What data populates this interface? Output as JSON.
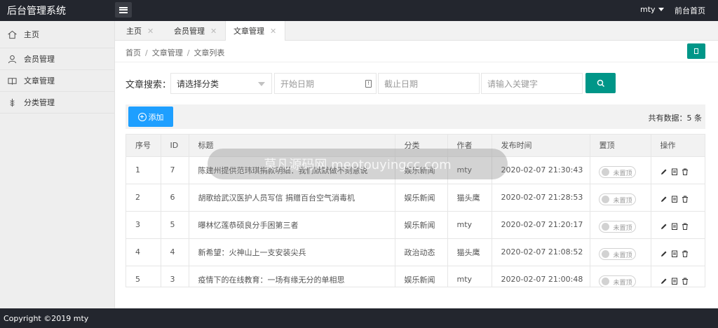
{
  "header": {
    "title": "后台管理系统",
    "user": "mty",
    "home_link": "前台首页"
  },
  "sidebar": {
    "items": [
      {
        "label": "主页",
        "icon": "home-icon"
      },
      {
        "label": "会员管理",
        "icon": "user-icon"
      },
      {
        "label": "文章管理",
        "icon": "book-icon"
      },
      {
        "label": "分类管理",
        "icon": "category-icon"
      }
    ]
  },
  "tabs": [
    {
      "label": "主页"
    },
    {
      "label": "会员管理"
    },
    {
      "label": "文章管理",
      "active": true
    }
  ],
  "breadcrumb": [
    "首页",
    "文章管理",
    "文章列表"
  ],
  "search": {
    "label": "文章搜索：",
    "category_placeholder": "请选择分类",
    "start_placeholder": "开始日期",
    "end_placeholder": "截止日期",
    "keyword_placeholder": "请输入关键字"
  },
  "toolbar": {
    "add_label": "添加",
    "total_text": "共有数据：5 条"
  },
  "table": {
    "headers": [
      "序号",
      "ID",
      "标题",
      "分类",
      "作者",
      "发布时间",
      "置顶",
      "操作"
    ],
    "rows": [
      {
        "no": "1",
        "id": "7",
        "title": "陈建州提供范玮琪捐款明细：我们默默做不刻意说",
        "category": "娱乐新闻",
        "author": "mty",
        "time": "2020-02-07 21:30:43",
        "pin": "未置顶"
      },
      {
        "no": "2",
        "id": "6",
        "title": "胡歌给武汉医护人员写信 捐赠百台空气消毒机",
        "category": "娱乐新闻",
        "author": "猫头鹰",
        "time": "2020-02-07 21:28:53",
        "pin": "未置顶"
      },
      {
        "no": "3",
        "id": "5",
        "title": "曝林忆莲恭硕良分手困第三者",
        "category": "娱乐新闻",
        "author": "mty",
        "time": "2020-02-07 21:20:17",
        "pin": "未置顶"
      },
      {
        "no": "4",
        "id": "4",
        "title": "新希望：火神山上一支安装尖兵",
        "category": "政治动态",
        "author": "猫头鹰",
        "time": "2020-02-07 21:08:52",
        "pin": "未置顶"
      },
      {
        "no": "5",
        "id": "3",
        "title": "疫情下的在线教育：一场有缘无分的单相思",
        "category": "娱乐新闻",
        "author": "mty",
        "time": "2020-02-07 21:00:48",
        "pin": "未置顶"
      }
    ]
  },
  "watermark": "莫凡源码网 meotouyingcc.com",
  "footer": {
    "copyright": "Copyright ©2019 mty"
  },
  "colors": {
    "header_bg": "#23262e",
    "primary": "#009688",
    "add_button": "#1e9fff"
  }
}
